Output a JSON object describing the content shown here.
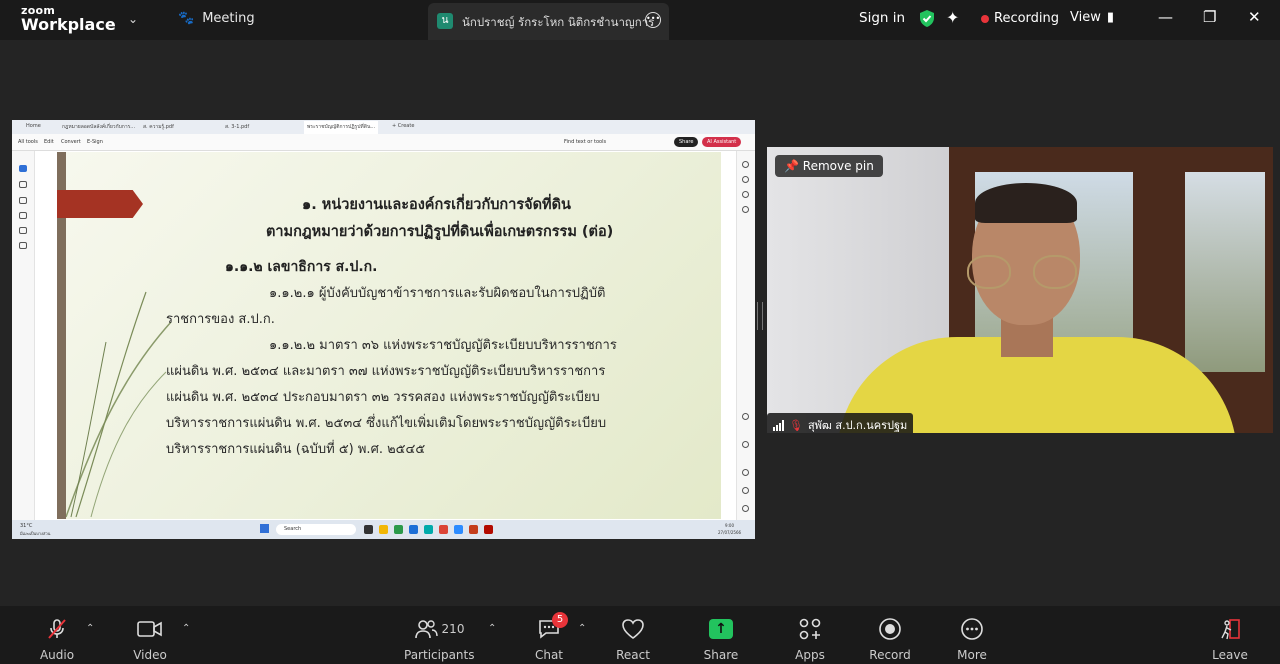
{
  "app": {
    "brand_top": "zoom",
    "brand_bottom": "Workplace"
  },
  "topbar": {
    "meeting_label": "Meeting",
    "tab_badge": "น",
    "tab_title": "นักปราชญ์ รักระโหก นิติกรชำนาญการ",
    "signin": "Sign in",
    "recording": "Recording",
    "view": "View",
    "recording_color": "#e8343a",
    "shield_color": "#22c35e"
  },
  "browser": {
    "tabs": [
      "Home",
      "กฎหมายลอดบัลลังค์เกี่ยวกับการ...",
      "ส. ความรู้.pdf",
      "ส. 3-1.pdf",
      "พระราชบัญญัติการปฏิรูปที่ดิน...",
      "+ Create"
    ],
    "tools": [
      "All tools",
      "Edit",
      "Convert",
      "E-Sign"
    ],
    "find": "Find text or tools",
    "share": "Share",
    "ai": "AI Assistant"
  },
  "slide": {
    "title1": "๑. หน่วยงานและองค์กรเกี่ยวกับการจัดที่ดิน",
    "title2": "ตามกฎหมายว่าด้วยการปฏิรูปที่ดินเพื่อเกษตรกรรม (ต่อ)",
    "heading": "๑.๑.๒ เลขาธิการ ส.ป.ก.",
    "lines": [
      "๑.๑.๒.๑ ผู้บังคับบัญชาข้าราชการและรับผิดชอบในการปฏิบัติ",
      "ราชการของ ส.ป.ก.",
      "๑.๑.๒.๒ มาตรา ๓๖ แห่งพระราชบัญญัติระเบียบบริหารราชการ",
      "แผ่นดิน พ.ศ. ๒๕๓๔ และมาตรา ๓๗ แห่งพระราชบัญญัติระเบียบบริหารราชการ",
      "แผ่นดิน พ.ศ. ๒๕๓๔ ประกอบมาตรา ๓๒ วรรคสอง แห่งพระราชบัญญัติระเบียบ",
      "บริหารราชการแผ่นดิน พ.ศ. ๒๕๓๔ ซึ่งแก้ไขเพิ่มเติมโดยพระราชบัญญัติระเบียบ",
      "บริหารราชการแผ่นดิน (ฉบับที่ ๕) พ.ศ. ๒๕๔๕"
    ]
  },
  "taskbar": {
    "weather": "31°C",
    "weather_sub": "มีเมฆเป็นบางส่วน",
    "search": "Search",
    "time": "9:00",
    "date": "27/07/2566"
  },
  "video": {
    "remove_pin": "Remove pin",
    "participant_name": "สุพัฒ ส.ป.ก.นครปฐม"
  },
  "toolbar": {
    "audio": "Audio",
    "video": "Video",
    "participants": "Participants",
    "participants_count": "210",
    "chat": "Chat",
    "chat_badge": "5",
    "react": "React",
    "share": "Share",
    "apps": "Apps",
    "record": "Record",
    "more": "More",
    "leave": "Leave"
  }
}
